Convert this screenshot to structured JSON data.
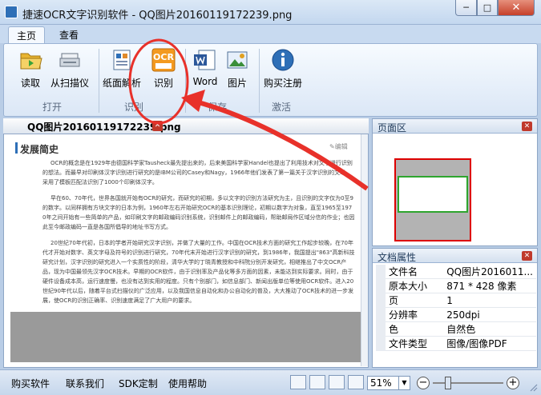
{
  "window": {
    "title": "捷速OCR文字识别软件 - QQ图片20160119172239.png",
    "min": "─",
    "max": "□",
    "close": "✕"
  },
  "ribbon_tabs": [
    "主页",
    "查看"
  ],
  "ribbon": {
    "buttons": [
      {
        "label": "读取",
        "icon": "folder-open-icon"
      },
      {
        "label": "从扫描仪",
        "icon": "scanner-icon"
      },
      {
        "label": "纸面解析",
        "icon": "page-parse-icon"
      },
      {
        "label": "识别",
        "icon": "ocr-recognize-icon",
        "badge": "OCR"
      },
      {
        "label": "Word",
        "icon": "word-doc-icon"
      },
      {
        "label": "图片",
        "icon": "picture-icon"
      },
      {
        "label": "购买注册",
        "icon": "info-icon"
      }
    ],
    "groups": [
      "打开",
      "识别",
      "保存",
      "激活"
    ]
  },
  "document": {
    "tab_label": "QQ图片20160119172239.png",
    "heading": "发展简史",
    "edit_link": "✎编辑",
    "paragraphs": [
      "OCR的概念是在1929年由德国科学家Tausheck最先提出来的，后来美国科学家Handel也提出了利用技术对文字进行识别的想法。而最早对印刷体汉字识别进行研究的是IBM公司的Casey和Nagy，1966年他们发表了第一篇关于汉字识别的文章，采用了模板匹配法识别了1000个印刷体汉字。",
      "早在60、70年代，世界各国就开始有OCR的研究，而研究的初期，多以文字的识别方法研究为主，且识别的文字仅为0至9的数字。以同样拥有方块文字的日本为例，1960年左右开始研究OCR的基本识别理论，初期以数字为对象，直至1965至1970年之间开始有一些简单的产品，如印刷文字的邮政编码识别系统，识别邮件上的邮政编码，帮助邮局作区域分信的作业；也因此至今邮政编码一直是各国所倡导的地址书写方式。",
      "20世纪70年代初，日本的学者开始研究汉字识别，并做了大量的工作。中国在OCR技术方面的研究工作起步较晚，在70年代才开始对数字、英文字母及符号的识别进行研究，70年代末开始进行汉字识别的研究，到1986年，我国提出\"863\"高新科技研究计划，汉字识别的研究进入一个实质性的阶段，清华大学的丁晓青教授和中科院分别开发研究，相继推出了中文OCR产品，现为中国最领先汉字OCR技术。早期的OCR软件，由于识别率及产品化等多方面的因素，未能达到实际要求。同时，由于硬件设备成本高，运行速度慢，也没有达到实用的程度。只有个别部门，如信息部门、新闻出版单位等使用OCR软件。进入20世纪90年代以后，随着平台式扫描仪的广泛应用，以及我国信息自动化和办公自动化的普及，大大推动了OCR技术的进一步发展，使OCR的识别正确率、识别速度满足了广大用户的要求。"
    ]
  },
  "preview": {
    "title": "页面区"
  },
  "properties": {
    "title": "文档属性",
    "rows": [
      {
        "key": "文件名",
        "value": "QQ图片2016011..."
      },
      {
        "key": "原本大小",
        "value": "871 * 428 像素"
      },
      {
        "key": "页",
        "value": "1"
      },
      {
        "key": "分辨率",
        "value": "250dpi"
      },
      {
        "key": "色",
        "value": "自然色"
      },
      {
        "key": "文件类型",
        "value": "图像/图像PDF"
      }
    ]
  },
  "statusbar": {
    "links": [
      "购买软件",
      "联系我们",
      "SDK定制",
      "使用帮助"
    ],
    "zoom": "51%",
    "zoom_level_percent": 51
  },
  "colors": {
    "accent": "#2e6fb7",
    "annotation": "#e8312a",
    "close": "#c0392b"
  }
}
